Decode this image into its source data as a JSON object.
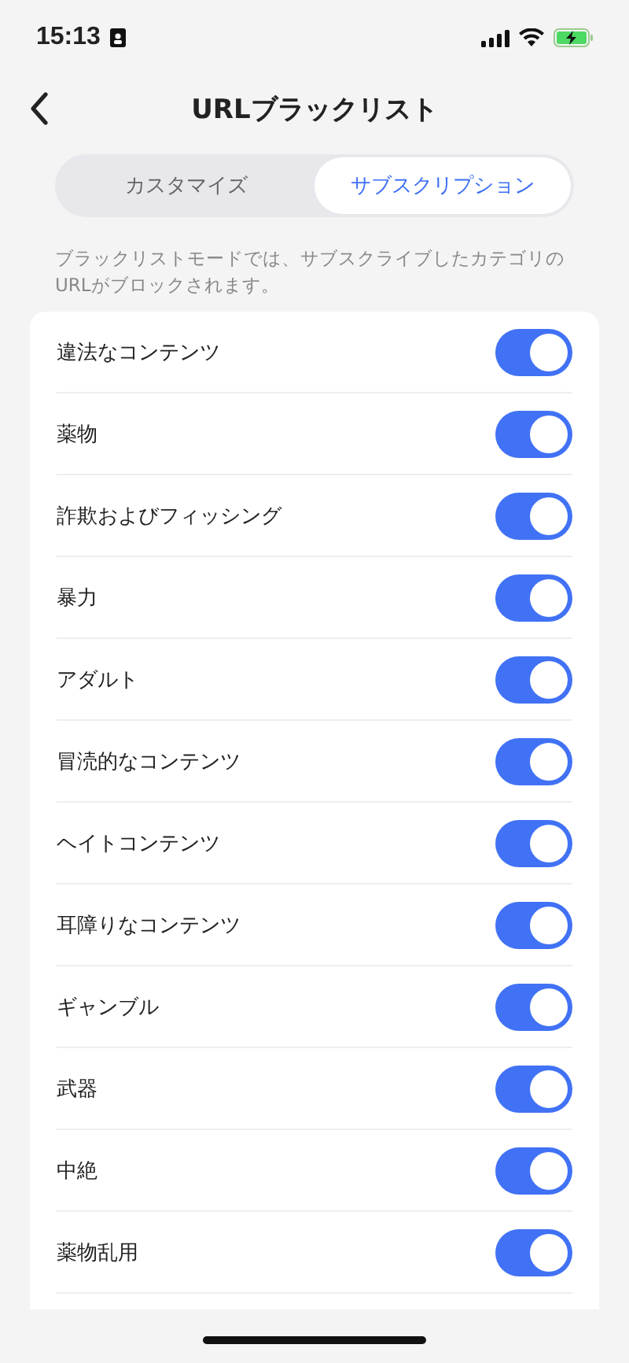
{
  "status_bar": {
    "time": "15:13"
  },
  "nav": {
    "title": "URLブラックリスト"
  },
  "tabs": [
    {
      "label": "カスタマイズ",
      "selected": false
    },
    {
      "label": "サブスクリプション",
      "selected": true
    }
  ],
  "description": "ブラックリストモードでは、サブスクライブしたカテゴリのURLがブロックされます。",
  "categories": [
    {
      "name": "違法なコンテンツ",
      "on": true
    },
    {
      "name": "薬物",
      "on": true
    },
    {
      "name": "詐欺およびフィッシング",
      "on": true
    },
    {
      "name": "暴力",
      "on": true
    },
    {
      "name": "アダルト",
      "on": true
    },
    {
      "name": "冒涜的なコンテンツ",
      "on": true
    },
    {
      "name": "ヘイトコンテンツ",
      "on": true
    },
    {
      "name": "耳障りなコンテンツ",
      "on": true
    },
    {
      "name": "ギャンブル",
      "on": true
    },
    {
      "name": "武器",
      "on": true
    },
    {
      "name": "中絶",
      "on": true
    },
    {
      "name": "薬物乱用",
      "on": true
    }
  ]
}
